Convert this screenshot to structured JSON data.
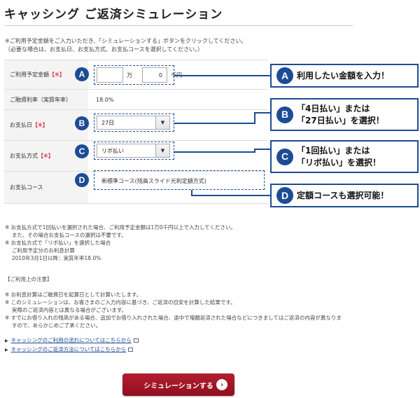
{
  "page_title": "キャッシング ご返済シミュレーション",
  "intro": "※ご利用予定金額をご入力いただき、「シミュレーションする」ボタンをクリックしてください。\n（必要な場合は、お支払日、お支払方式、お支払コースを選択してください。）",
  "form": {
    "amount": {
      "label": "ご利用予定金額",
      "required_mark": "【※】",
      "man_value": "",
      "man_unit": "万",
      "sen_value": "0",
      "sen_unit": "千円"
    },
    "rate": {
      "label": "ご融資利率（実質年率）",
      "value": "18.0%"
    },
    "payment_date": {
      "label": "お支払日",
      "required_mark": "【※】",
      "selected": "27日"
    },
    "payment_method": {
      "label": "お支払方式",
      "required_mark": "【※】",
      "selected": "リボ払い"
    },
    "payment_course": {
      "label": "お支払コース",
      "value": "新標準コース(残高スライド元利定額方式)"
    }
  },
  "badges": {
    "a": "A",
    "b": "B",
    "c": "C",
    "d": "D"
  },
  "callouts": {
    "a": "利用したい金額を入力！",
    "b": "「4日払い」または\n「27日払い」を選択！",
    "c": "「1回払い」または\n「リボ払い」を選択！",
    "d": "定額コースも選択可能！"
  },
  "notes_block1": "※ お支払方式で1回払いを選択された場合、ご利用予定金額は1万0千円以上で入力してください。\n　 また、その場合お支払コースの選択は不要です。\n※ お支払方式で「リボ払い」を選択した場合\n　 ご利用予定分のお利息計算\n　 2010年3月1日以降：実質年率18.0%",
  "notes_heading": "【ご利用上の注意】",
  "notes_block2": "※ お利息計算はご融資日を起算日として計算いたします。\n※ このシミュレーションは、お客さまのご入力内容に基づき、ご返済の目安を計算した結果です。\n　 実際のご返済内容とは異なる場合がございます。\n※ すでにお借り入れの残高がある場合、追加でお借り入れされた場合、途中で増額返済された場合などにつきましてはご返済の内容が異なりま\n　 すので、あらかじめご了承ください。",
  "links": {
    "flow": "キャッシングのご利用の流れについてはこちらから",
    "repay": "キャッシングのご返済方法についてはこちらから"
  },
  "submit_label": "シミュレーションする",
  "colors": {
    "accent": "#1d4c95",
    "button": "#a4172a",
    "required": "#d0021b"
  }
}
